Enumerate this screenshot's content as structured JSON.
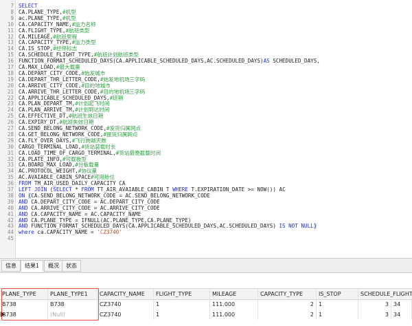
{
  "editor": {
    "lines": [
      {
        "n": "7",
        "html": "<span class='kw'>SELECT</span>"
      },
      {
        "n": "8",
        "html": "CA.PLANE_TYPE,<span class='cm'>#机型</span>"
      },
      {
        "n": "9",
        "html": "ac.PLANE_TYPE,<span class='cm'>#机型</span>"
      },
      {
        "n": "10",
        "html": "CA.CAPACITY_NAME,<span class='cm'>#运力名称</span>"
      },
      {
        "n": "11",
        "html": "CA.FLIGHT_TYPE,<span class='cm'>#航班类型</span>"
      },
      {
        "n": "12",
        "html": "CA.MILEAGE,<span class='cm'>#航班里程</span>"
      },
      {
        "n": "13",
        "html": "CA.CAPACITY_TYPE,<span class='cm'>#运力类型</span>"
      },
      {
        "n": "14",
        "html": "CA.IS_STOP,<span class='cm'>#经停标志</span>"
      },
      {
        "n": "15",
        "html": "CA.SCHEDULE_FLIGHT_TYPE,<span class='cm'>#航班计划航班类型</span>"
      },
      {
        "n": "16",
        "html": "FUNCTION_FORMAT_SCHEDULED_DAYS(CA.APPLICABLE_SCHEDULED_DAYS,AC.SCHEDULED_DAYS)<span class='kw'>AS</span> SCHEDULED_DAYS,"
      },
      {
        "n": "17",
        "html": "CA.MAX_LOAD,<span class='cm'>#最大载量</span>"
      },
      {
        "n": "18",
        "html": "CA.DEPART_CITY_CODE,<span class='cm'>#始发城市</span>"
      },
      {
        "n": "19",
        "html": "CA.DEPART_THR_LETTER_CODE,<span class='cm'>#始发地机场三字码</span>"
      },
      {
        "n": "20",
        "html": "CA.ARRIVE_CITY_CODE,<span class='cm'>#目的地城市</span>"
      },
      {
        "n": "21",
        "html": "CA.ARRIVE_THR_LETTER_CODE,<span class='cm'>#目的地机场三字码</span>"
      },
      {
        "n": "22",
        "html": "CA.APPLICABLE_SCHEDULED_DAYS,<span class='cm'>#班期</span>"
      },
      {
        "n": "23",
        "html": "CA.PLAN_DEPART_TM,<span class='cm'>#计划起飞时间</span>"
      },
      {
        "n": "24",
        "html": "CA.PLAN_ARRIVE_TM,<span class='cm'>#计划到达时间</span>"
      },
      {
        "n": "25",
        "html": "CA.EFFECTIVE_DT,<span class='cm'>#航班生效日期</span>"
      },
      {
        "n": "26",
        "html": "CA.EXPIRY_DT,<span class='cm'>#航班失效日期</span>"
      },
      {
        "n": "27",
        "html": "CA.SEND_BELONG_NETWORK_CODE,<span class='cm'>#发货归属网点</span>"
      },
      {
        "n": "28",
        "html": "CA.GET_BELONG_NETWORK_CODE,<span class='cm'>#提货归属网点</span>"
      },
      {
        "n": "29",
        "html": "CA.FLY_OVER_DAYS,<span class='cm'>#飞行跨越天数</span>"
      },
      {
        "n": "30",
        "html": "CARGO_TERMINAL_LOAD,<span class='cm'>#货站装载时长</span>"
      },
      {
        "n": "31",
        "html": "CA.LOAD_TIME_OF_CARGO_TERMINAL,<span class='cm'>#货站最晚截载时间</span>"
      },
      {
        "n": "32",
        "html": "CA.PLATE_INFO,<span class='cm'>#可载板型</span>"
      },
      {
        "n": "33",
        "html": "CA.BOARD_MAX_LOAD,<span class='cm'>#分板载量</span>"
      },
      {
        "n": "34",
        "html": "AC.PROTOCOL_WEIGHT,<span class='cm'>#协议量</span>"
      },
      {
        "n": "35",
        "html": "AC.AVAIABLE_CABIN_SPACE<span class='cm'>#可用舱位</span>"
      },
      {
        "n": "36",
        "html": "<span class='kw'>FROM</span> TM_AIR_USED_DAILY_CAPACITY CA"
      },
      {
        "n": "37",
        "html": "<span class='kw'>LEFT JOIN</span> (<span class='kw'>SELECT</span> * <span class='kw'>FROM</span> TT_AIR_AVAIABLE_CABIN T <span class='kw'>WHERE</span> T.EXPIRATION_DATE &gt;= NOW()) AC"
      },
      {
        "n": "38",
        "html": "<span class='kw'>ON</span> <span class='sel'>(</span>CA.SEND_BELONG_NETWORK_CODE = AC.SEND_BELONG_NETWORK_CODE"
      },
      {
        "n": "39",
        "html": "<span class='kw'>AND</span> CA.DEPART_CITY_CODE = AC.DEPART_CITY_CODE"
      },
      {
        "n": "40",
        "html": "<span class='kw'>AND</span> CA.ARRIVE_CITY_CODE = AC.ARRIVE_CITY_CODE"
      },
      {
        "n": "41",
        "html": "<span class='kw'>AND</span> CA.CAPACITY_NAME = AC.CAPACITY_NAME"
      },
      {
        "n": "42",
        "html": "<span class='kw'>AND</span> CA.PLANE_TYPE = IFNULL(AC.PLANE_TYPE,CA.PLANE_TYPE)"
      },
      {
        "n": "43",
        "html": "<span class='kw'>AND</span> FUNCTION_FORMAT_SCHEDULED_DAYS(CA.APPLICABLE_SCHEDULED_DAYS,AC.SCHEDULED_DAYS) <span class='kw'>IS NOT NULL</span><span class='sel'>)</span>"
      },
      {
        "n": "44",
        "html": "<span class='kw'>where</span> ca.CAPACITY_NAME = <span class='st'>'CZ3740'</span>"
      },
      {
        "n": "45",
        "html": ""
      }
    ]
  },
  "tabs": [
    "信息",
    "结果1",
    "概况",
    "状态"
  ],
  "active_tab": 1,
  "result": {
    "columns": [
      "PLANE_TYPE",
      "PLANE_TYPE1",
      "CAPACITY_NAME",
      "FLIGHT_TYPE",
      "MILEAGE",
      "CAPACITY_TYPE",
      "IS_STOP",
      "SCHEDULE_FLIGHT_TYPE",
      "SCHEDU"
    ],
    "rows": [
      [
        "B738",
        "B738",
        "CZ3740",
        "1",
        "111.000",
        "2",
        "1",
        "3",
        "34"
      ],
      [
        "B738",
        "(Null)",
        "CZ3740",
        "1",
        "111.000",
        "2",
        "1",
        "3",
        "34"
      ]
    ]
  }
}
